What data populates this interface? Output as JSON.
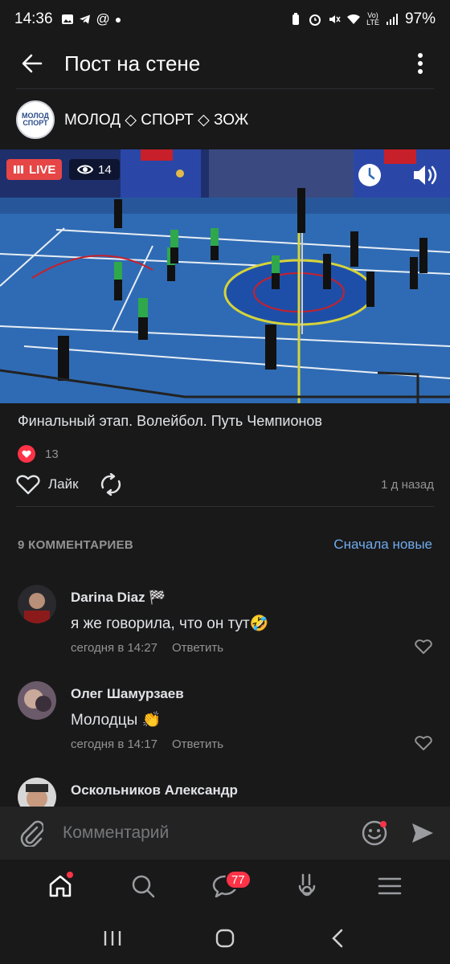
{
  "status_bar": {
    "time": "14:36",
    "battery": "97%",
    "icons": [
      "image-icon",
      "telegram-icon",
      "at-icon",
      "dot-icon",
      "battery-saver-icon",
      "alarm-icon",
      "mute-icon",
      "wifi-icon",
      "volte-icon",
      "signal-icon"
    ]
  },
  "header": {
    "title": "Пост на стене",
    "back_icon": "arrow-left-icon",
    "menu_icon": "more-vertical-icon"
  },
  "community": {
    "name": "МОЛОД ◇ СПОРТ ◇ ЗОЖ",
    "logo_text_top": "МОЛОД",
    "logo_text_bottom": "СПОРТ"
  },
  "video": {
    "live_label": "LIVE",
    "viewers": "14"
  },
  "post": {
    "text": "Финальный этап. Волейбол. Путь Чемпионов",
    "likes_count": "13",
    "like_label": "Лайк",
    "time_ago": "1 д назад"
  },
  "comments": {
    "count_label": "9 КОММЕНТАРИЕВ",
    "sort_label": "Сначала новые",
    "reply_label": "Ответить",
    "items": [
      {
        "author": "Darina Diaz 🏁",
        "text": "я же говорила, что он тут🤣",
        "time": "сегодня в 14:27"
      },
      {
        "author": "Олег Шамурзаев",
        "text": "Молодцы 👏",
        "time": "сегодня в 14:17"
      },
      {
        "author": "Оскольников Александр"
      }
    ]
  },
  "comment_input": {
    "placeholder": "Комментарий"
  },
  "bottom_nav": {
    "messages_badge": "77",
    "items": [
      "home-icon",
      "search-icon",
      "messages-icon",
      "clips-icon",
      "menu-icon"
    ]
  },
  "colors": {
    "background": "#19191a",
    "accent": "#71aaeb",
    "live_red": "#e64646",
    "badge_red": "#ff3347",
    "muted_text": "#939393"
  }
}
